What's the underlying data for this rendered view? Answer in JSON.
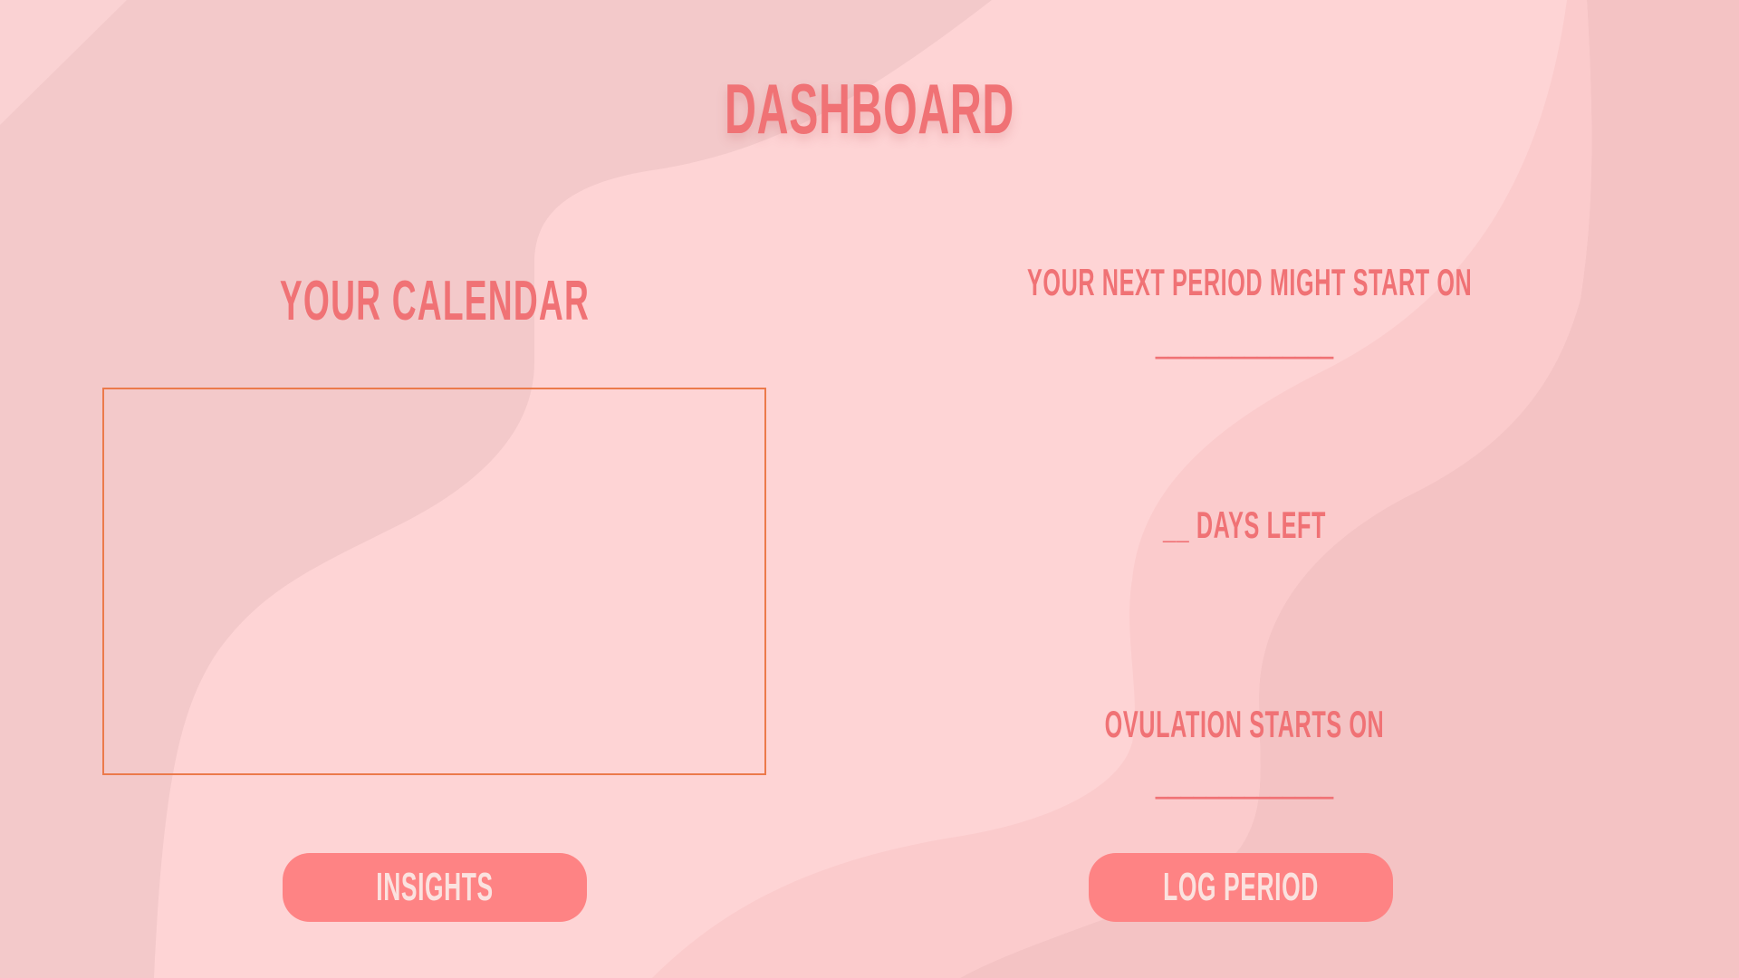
{
  "header": {
    "title": "DASHBOARD"
  },
  "calendar": {
    "title": "YOUR CALENDAR"
  },
  "prediction": {
    "next_period_label": "YOUR NEXT PERIOD MIGHT START ON",
    "next_period_value": "______________",
    "days_left": "__ DAYS LEFT",
    "ovulation_label": "OVULATION STARTS ON",
    "ovulation_value": "______________"
  },
  "actions": {
    "insights_label": "INSIGHTS",
    "log_period_label": "LOG PERIOD"
  },
  "colors": {
    "background": "#fed4d5",
    "accent_text": "#f07275",
    "button": "#fe8384",
    "button_text": "#fbe2df",
    "calendar_border": "#ec7a4b"
  }
}
